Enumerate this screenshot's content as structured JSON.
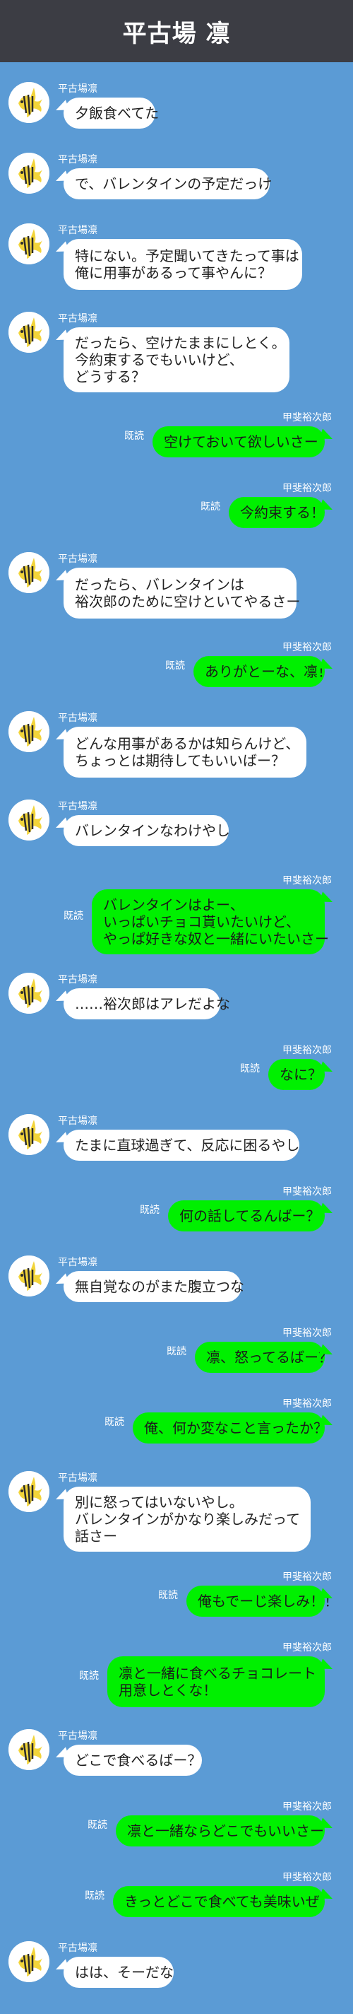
{
  "header": {
    "title": "平古場 凛"
  },
  "names": {
    "rin": "平古場凛",
    "kai": "甲斐裕次郎"
  },
  "read_label": "既読",
  "icons": {
    "avatar": "angelfish-avatar-icon"
  },
  "colors": {
    "background": "#5b9bd5",
    "header": "#3c3d44",
    "incoming_bubble": "#ffffff",
    "outgoing_bubble": "#00f000"
  },
  "messages": [
    {
      "from": "rin",
      "lines": [
        "夕飯食べてた"
      ]
    },
    {
      "from": "rin",
      "lines": [
        "で、バレンタインの予定だっけ"
      ]
    },
    {
      "from": "rin",
      "lines": [
        "特にない。予定聞いてきたって事は",
        "俺に用事があるって事やんに？"
      ]
    },
    {
      "from": "rin",
      "lines": [
        "だったら、空けたままにしとく。",
        "今約束するでもいいけど、",
        "どうする？"
      ]
    },
    {
      "from": "kai",
      "lines": [
        "空けておいて欲しいさー"
      ]
    },
    {
      "from": "kai",
      "lines": [
        "今約束する！"
      ]
    },
    {
      "from": "rin",
      "lines": [
        "だったら、バレンタインは",
        "裕次郎のために空けといてやるさー"
      ]
    },
    {
      "from": "kai",
      "lines": [
        "ありがとーな、凛！"
      ]
    },
    {
      "from": "rin",
      "lines": [
        "どんな用事があるかは知らんけど、",
        "ちょっとは期待してもいいばー？"
      ]
    },
    {
      "from": "rin",
      "lines": [
        "バレンタインなわけやし"
      ]
    },
    {
      "from": "kai",
      "lines": [
        "バレンタインはよー、",
        "いっぱいチョコ貰いたいけど、",
        "やっぱ好きな奴と一緒にいたいさー"
      ]
    },
    {
      "from": "rin",
      "lines": [
        "……裕次郎はアレだよな"
      ]
    },
    {
      "from": "kai",
      "lines": [
        "なに？"
      ]
    },
    {
      "from": "rin",
      "lines": [
        "たまに直球過ぎて、反応に困るやし"
      ]
    },
    {
      "from": "kai",
      "lines": [
        "何の話してるんばー？"
      ]
    },
    {
      "from": "rin",
      "lines": [
        "無自覚なのがまた腹立つな"
      ]
    },
    {
      "from": "kai",
      "lines": [
        "凛、怒ってるばー？"
      ]
    },
    {
      "from": "kai",
      "lines": [
        "俺、何か変なこと言ったか？"
      ]
    },
    {
      "from": "rin",
      "lines": [
        "別に怒ってはいないやし。",
        "バレンタインがかなり楽しみだって",
        "話さー"
      ]
    },
    {
      "from": "kai",
      "lines": [
        "俺もでーじ楽しみ！！"
      ]
    },
    {
      "from": "kai",
      "lines": [
        "凛と一緒に食べるチョコレート",
        "用意しとくな！"
      ]
    },
    {
      "from": "rin",
      "lines": [
        "どこで食べるばー？"
      ]
    },
    {
      "from": "kai",
      "lines": [
        "凛と一緒ならどこでもいいさー"
      ]
    },
    {
      "from": "kai",
      "lines": [
        "きっとどこで食べても美味いぜ"
      ]
    },
    {
      "from": "rin",
      "lines": [
        "はは、そーだな"
      ]
    }
  ]
}
